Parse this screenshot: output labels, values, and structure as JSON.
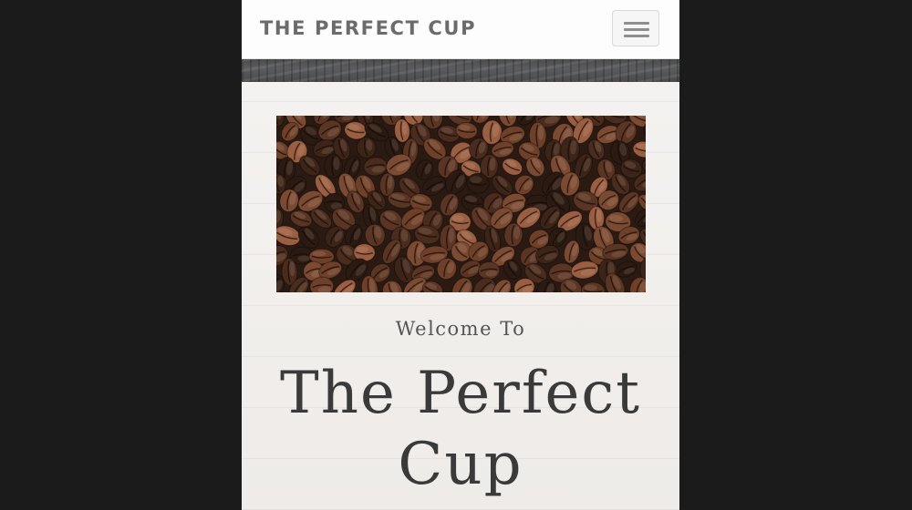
{
  "navbar": {
    "brand": "THE PERFECT CUP",
    "menu_icon": "hamburger-menu-icon"
  },
  "hero": {
    "image": "coffee-beans-photo",
    "colors": {
      "dark": "#2a1a12",
      "mid": "#5a3524",
      "light": "#9a5f43"
    }
  },
  "intro": {
    "welcome": "Welcome To",
    "title": "The Perfect Cup"
  }
}
